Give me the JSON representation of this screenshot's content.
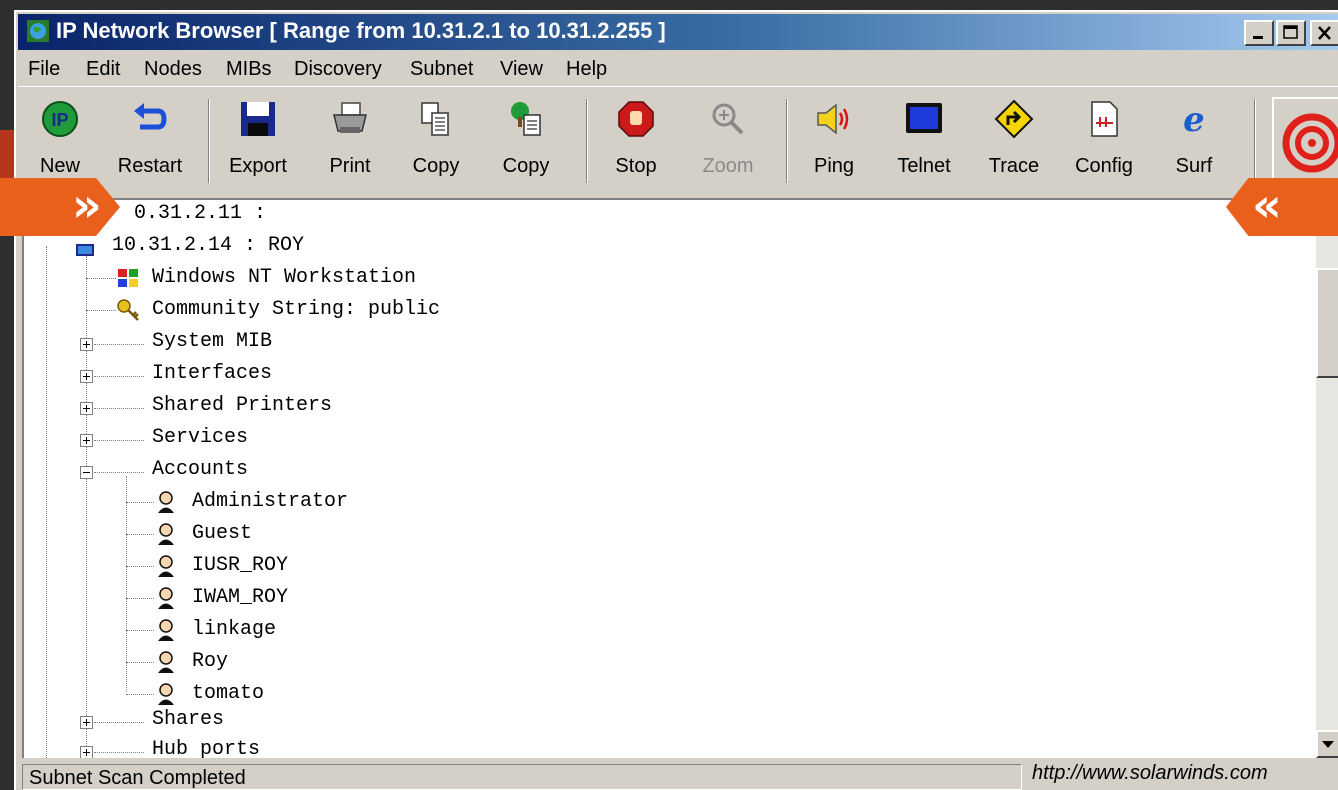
{
  "window": {
    "title": "IP Network Browser [ Range from 10.31.2.1 to 10.31.2.255 ]",
    "title_icon": "globe-icon"
  },
  "menu": [
    "File",
    "Edit",
    "Nodes",
    "MIBs",
    "Discovery",
    "Subnet",
    "View",
    "Help"
  ],
  "toolbar": {
    "buttons": [
      {
        "label": "New",
        "icon": "ip-new-icon"
      },
      {
        "label": "Restart",
        "icon": "restart-arrow-icon"
      },
      {
        "label": "Export",
        "icon": "floppy-disk-icon"
      },
      {
        "label": "Print",
        "icon": "printer-icon"
      },
      {
        "label": "Copy",
        "icon": "copy-pages-icon"
      },
      {
        "label": "Copy",
        "icon": "copy-tree-icon"
      },
      {
        "label": "Stop",
        "icon": "stop-hand-icon"
      },
      {
        "label": "Zoom",
        "icon": "magnifier-icon",
        "disabled": true
      },
      {
        "label": "Ping",
        "icon": "speaker-icon"
      },
      {
        "label": "Telnet",
        "icon": "monitor-icon"
      },
      {
        "label": "Trace",
        "icon": "trace-sign-icon"
      },
      {
        "label": "Config",
        "icon": "config-doc-icon"
      },
      {
        "label": "Surf",
        "icon": "ie-icon"
      }
    ],
    "logo_icon": "solarwinds-logo-icon"
  },
  "tree": {
    "rows": [
      {
        "text": "0.31.2.11      :",
        "kind": "host"
      },
      {
        "text": "10.31.2.14     : ROY",
        "kind": "host"
      },
      {
        "text": "Windows NT Workstation",
        "kind": "info",
        "icon": "windows-logo-icon"
      },
      {
        "text": "Community String: public",
        "kind": "info",
        "icon": "key-icon"
      },
      {
        "text": "System MIB",
        "kind": "node"
      },
      {
        "text": "Interfaces",
        "kind": "node"
      },
      {
        "text": "Shared Printers",
        "kind": "node"
      },
      {
        "text": "Services",
        "kind": "node"
      },
      {
        "text": "Accounts",
        "kind": "node-open"
      },
      {
        "text": "Administrator",
        "kind": "user"
      },
      {
        "text": "Guest",
        "kind": "user"
      },
      {
        "text": "IUSR_ROY",
        "kind": "user"
      },
      {
        "text": "IWAM_ROY",
        "kind": "user"
      },
      {
        "text": "linkage",
        "kind": "user"
      },
      {
        "text": "Roy",
        "kind": "user"
      },
      {
        "text": "tomato",
        "kind": "user"
      },
      {
        "text": "Shares",
        "kind": "node"
      },
      {
        "text": "Hub ports",
        "kind": "node"
      }
    ]
  },
  "status": {
    "text": "Subnet Scan Completed",
    "url": "http://www.solarwinds.com"
  },
  "colors": {
    "accent_orange": "#e8601c",
    "titlebar_start": "#0a246a",
    "titlebar_end": "#a6caf0",
    "chrome": "#d4d0c8"
  }
}
